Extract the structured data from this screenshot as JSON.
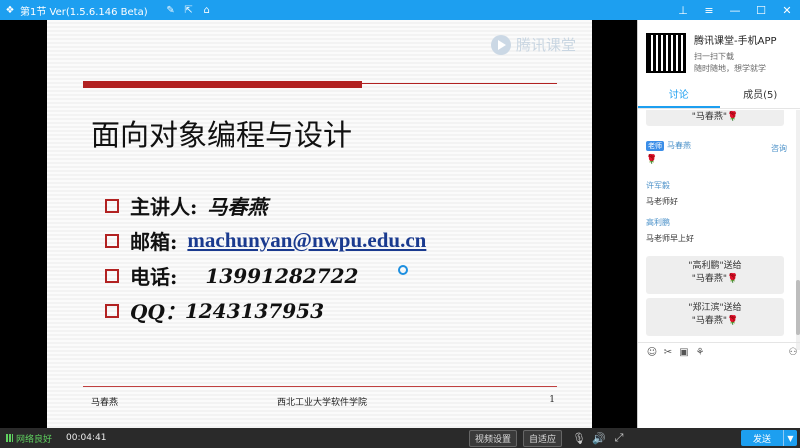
{
  "titlebar": {
    "title": "第1节 Ver(1.5.6.146 Beta)",
    "tool_icons": [
      "edit-icon",
      "share-icon",
      "home-icon"
    ],
    "window_icons": [
      "pin-icon",
      "menu-icon",
      "minimize-icon",
      "maximize-icon",
      "close-icon"
    ]
  },
  "slide": {
    "brand": "腾讯课堂",
    "title": "面向对象编程与设计",
    "items": [
      {
        "label": "主讲人:",
        "value": "马春燕"
      },
      {
        "label": "邮箱:",
        "value": "machunyan@nwpu.edu.cn"
      },
      {
        "label": "电话:",
        "value": "13991282722"
      },
      {
        "label": "QQ：",
        "value": "1243137953"
      }
    ],
    "footer": {
      "left": "马春燕",
      "center": "西北工业大学软件学院",
      "page": "1"
    }
  },
  "bottombar": {
    "network": "网络良好",
    "time": "00:04:41",
    "video_settings": "视频设置",
    "fit": "自适应",
    "send": "发送"
  },
  "side": {
    "promo": {
      "title": "腾讯课堂-手机APP",
      "line1": "扫一扫下载",
      "line2": "随时随地，想学就学"
    },
    "tabs": [
      {
        "label": "讨论",
        "active": true
      },
      {
        "label": "成员(5)",
        "active": false
      }
    ],
    "chat": {
      "gift_top": "\"马春燕\"",
      "teacher_badge": "老师",
      "teacher_name": "马春燕",
      "ask_label": "咨询",
      "msg1_name": "许军毅",
      "msg1_text": "马老师好",
      "msg2_name": "高利鹏",
      "msg2_text": "马老师早上好",
      "gift1_line1": "\"高利鹏\"送给",
      "gift1_line2": "\"马春燕\"",
      "gift2_line1": "\"郑江滨\"送给",
      "gift2_line2": "\"马春燕\""
    }
  }
}
